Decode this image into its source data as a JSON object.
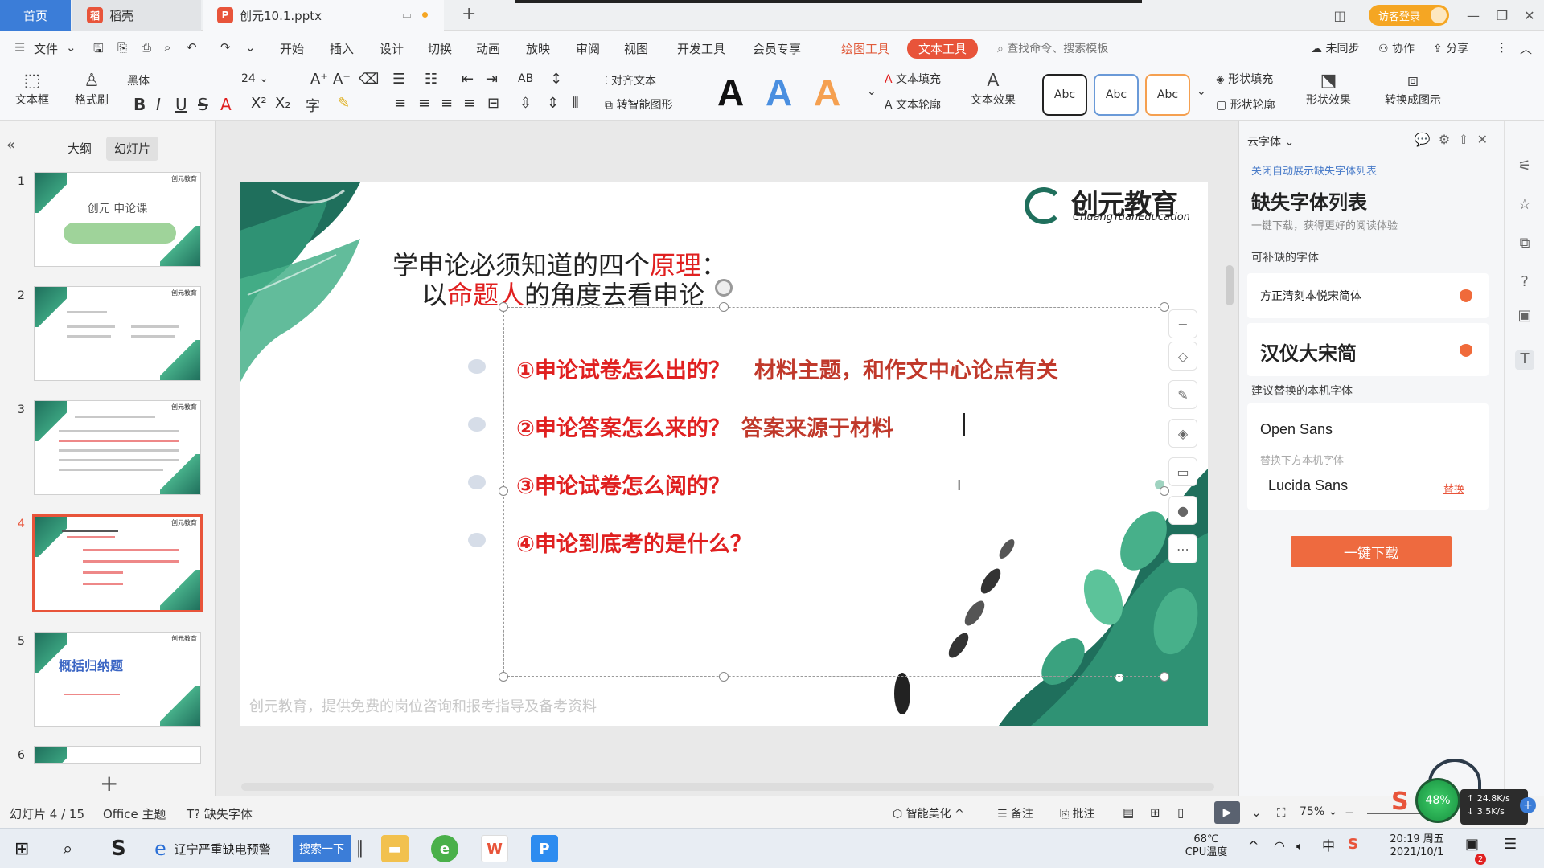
{
  "titlebar": {
    "home_tab": "首页",
    "tabs": [
      {
        "label": "稻壳",
        "logo": "稻"
      },
      {
        "label": "创元10.1.pptx",
        "logo": "P"
      }
    ],
    "login_label": "访客登录",
    "colors": {
      "home": "#3b7dd8",
      "wps_red": "#e8543a",
      "ppt_orange": "#e8543a"
    }
  },
  "menubar": {
    "file_label": "文件",
    "items": [
      "开始",
      "插入",
      "设计",
      "切换",
      "动画",
      "放映",
      "审阅",
      "视图",
      "开发工具",
      "会员专享"
    ],
    "context_draw": "绘图工具",
    "context_text": "文本工具",
    "search_placeholder": "查找命令、搜索模板",
    "right": [
      "未同步",
      "协作",
      "分享"
    ]
  },
  "toolbar": {
    "textbox_label": "文本框",
    "format_brush_label": "格式刷",
    "font_name": "黑体",
    "font_size": "24",
    "align_text_label": "对齐文本",
    "smartart_label": "转智能图形",
    "text_fill_label": "文本填充",
    "text_outline_label": "文本轮廓",
    "text_effect_label": "文本效果",
    "abc_styles": [
      "Abc",
      "Abc",
      "Abc"
    ],
    "shape_fill_label": "形状填充",
    "shape_outline_label": "形状轮廓",
    "shape_effect_label": "形状效果",
    "convert_label": "转换成图示",
    "bigA_letter": "A"
  },
  "leftpanel": {
    "tabs": [
      "大纲",
      "幻灯片"
    ],
    "active_tab": "幻灯片",
    "thumbs": [
      {
        "num": "1",
        "title": "创元 申论课"
      },
      {
        "num": "2",
        "title": ""
      },
      {
        "num": "3",
        "title": ""
      },
      {
        "num": "4",
        "title": ""
      },
      {
        "num": "5",
        "title": "概括归纳题"
      },
      {
        "num": "6",
        "title": ""
      }
    ],
    "thumb_logo": "创元教育"
  },
  "slide": {
    "logo_cn": "创元教育",
    "logo_en": "ChuangYuanEducation",
    "heading_line1_pre": "学申论必须知道的四个",
    "heading_line1_hl": "原理",
    "heading_line1_post": "：",
    "heading_line2_pre": "以",
    "heading_line2_hl": "命题人",
    "heading_line2_post": "的角度去看申论",
    "items": [
      {
        "q": "①申论试卷怎么出的？",
        "a": "材料主题，和作文中心论点有关"
      },
      {
        "q": "②申论答案怎么来的？",
        "a": "答案来源于材料"
      },
      {
        "q": "③申论试卷怎么阅的？",
        "a": ""
      },
      {
        "q": "④申论到底考的是什么？",
        "a": ""
      }
    ],
    "footer": "创元教育，提供免费的岗位咨询和报考指导及备考资料"
  },
  "rightpanel": {
    "title": "云字体",
    "link": "关闭自动展示缺失字体列表",
    "heading": "缺失字体列表",
    "subheading": "一键下载，获得更好的阅读体验",
    "available_label": "可补缺的字体",
    "missing_fonts": [
      "方正清刻本悦宋简体",
      "汉仪大宋简"
    ],
    "suggest_label": "建议替换的本机字体",
    "suggest_font": "Open Sans",
    "replace_hint": "替换下方本机字体",
    "local_font": "Lucida Sans",
    "replace_link": "替换",
    "download_button": "一键下载"
  },
  "statusbar": {
    "slide_info": "幻灯片 4 / 15",
    "theme": "Office 主题",
    "missing_font": "缺失字体",
    "beautify": "智能美化",
    "notes": "备注",
    "comments": "批注",
    "zoom": "75%",
    "cpu_percent": "48%",
    "net_up": "24.8K/s",
    "net_down": "3.5K/s"
  },
  "taskbar": {
    "news_label": "辽宁严重缺电预警",
    "search_button": "搜索一下",
    "temp": "68℃",
    "temp_label": "CPU温度",
    "time": "20:19 周五",
    "date": "2021/10/1",
    "ime": "中",
    "notif_count": "2"
  }
}
